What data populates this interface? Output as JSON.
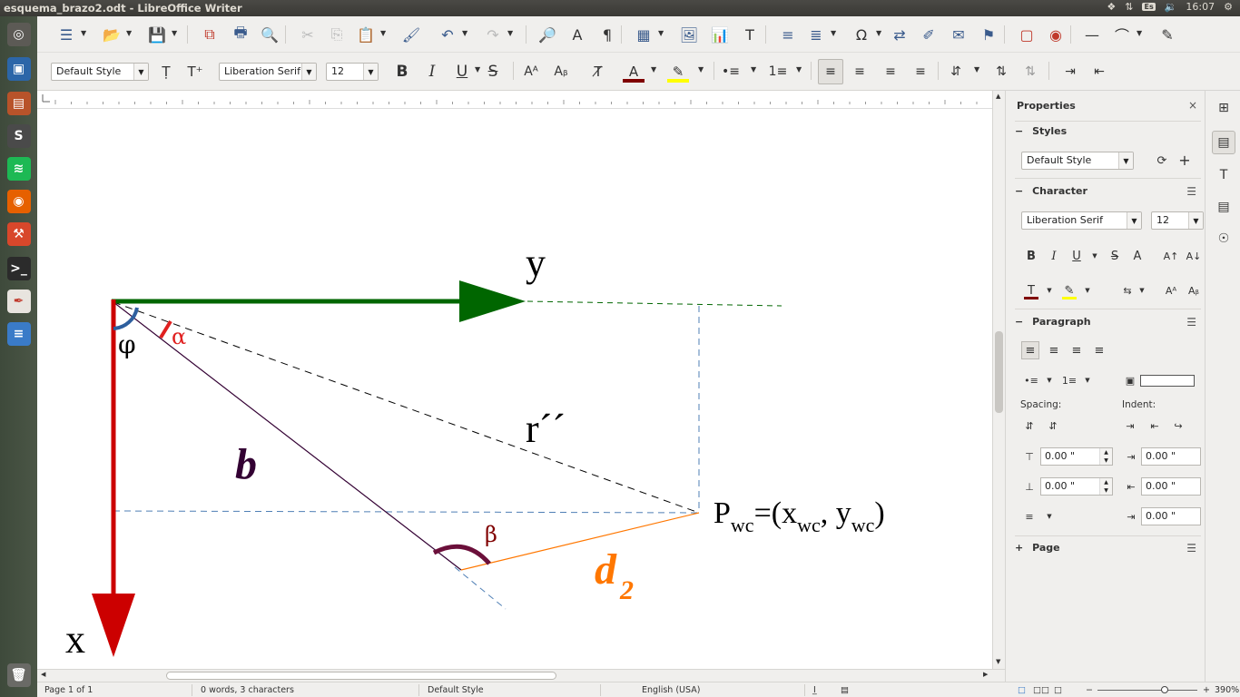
{
  "window": {
    "title": "esquema_brazo2.odt - LibreOffice Writer"
  },
  "tray": {
    "keyboard": "Es",
    "volume": "🔉",
    "clock": "16:07"
  },
  "launcher": [
    {
      "name": "ubuntu-dash",
      "color": "#5c5a55",
      "glyph": "◎"
    },
    {
      "name": "virtualbox",
      "color": "#2c66a8",
      "glyph": "▣"
    },
    {
      "name": "files",
      "color": "#b8532a",
      "glyph": "▤"
    },
    {
      "name": "sublime-text",
      "color": "#4a4a4a",
      "glyph": "S"
    },
    {
      "name": "spotify",
      "color": "#1db954",
      "glyph": "≋"
    },
    {
      "name": "firefox",
      "color": "#e66000",
      "glyph": "◉"
    },
    {
      "name": "system-settings",
      "color": "#d8472b",
      "glyph": "⚒"
    },
    {
      "name": "terminal",
      "color": "#2b2b2b",
      "glyph": ">_"
    },
    {
      "name": "libreoffice-draw",
      "color": "#e8e4df",
      "glyph": "✒"
    },
    {
      "name": "libreoffice-writer",
      "color": "#3a7bc8",
      "glyph": "≡"
    }
  ],
  "trash": {
    "glyph": "🗑"
  },
  "formatting": {
    "paragraph_style": "Default Style",
    "font_name": "Liberation Serif",
    "font_size": "12",
    "bold": "B",
    "italic": "I",
    "underline": "U",
    "strike": "S"
  },
  "toolbar_icons": {
    "sidebar": "☰",
    "open": "📂",
    "save": "💾",
    "export_pdf": "⧉",
    "print": "🖶",
    "print_preview": "🔍",
    "cut": "✂",
    "copy": "⎘",
    "paste": "📋",
    "clone": "🖌",
    "undo": "↶",
    "redo": "↷",
    "find": "🔎",
    "spelling": "A",
    "formatting_marks": "¶",
    "table": "▦",
    "image": "🖼",
    "chart": "📊",
    "textbox": "T",
    "page_break": "≡",
    "field": "≣",
    "special_char": "Ω",
    "hyperlink": "⇄",
    "footnote": "✐",
    "comment": "✉",
    "bookmark": "⚑",
    "track_changes": "▢",
    "record": "◉",
    "line": "—",
    "curve": "⌒",
    "draw": "✎"
  },
  "diagram": {
    "labels": {
      "y": "y",
      "x": "x",
      "phi": "φ",
      "alpha": "α",
      "r": "r´´",
      "b": "b",
      "beta": "β",
      "d_main": "d",
      "d_sub": "2",
      "p_main": "P",
      "p_sub": "wc",
      "p_mid1": "=(x",
      "p_sub2": "wc",
      "p_mid2": ", y",
      "p_sub3": "wc",
      "p_end": ")"
    },
    "colors": {
      "x_axis": "#cc0000",
      "y_axis": "#006600",
      "phi_arc": "#2e5f9e",
      "alpha_arc": "#e02020",
      "b_line": "#330033",
      "beta_arc": "#6b0f3a",
      "d2_line": "#ff7700",
      "dashed_blue": "#4f7fb5"
    }
  },
  "sidebar": {
    "title": "Properties",
    "styles": {
      "heading": "Styles",
      "value": "Default Style"
    },
    "character": {
      "heading": "Character",
      "font_name": "Liberation Serif",
      "font_size": "12"
    },
    "paragraph": {
      "heading": "Paragraph",
      "spacing_label": "Spacing:",
      "indent_label": "Indent:",
      "above": "0.00 \"",
      "below": "0.00 \"",
      "before_text": "0.00 \"",
      "after_text": "0.00 \"",
      "first_line": "0.00 \""
    },
    "page": {
      "heading": "Page"
    }
  },
  "statusbar": {
    "page": "Page 1 of 1",
    "words": "0 words, 3 characters",
    "style": "Default Style",
    "language": "English (USA)",
    "zoom": "390%"
  }
}
